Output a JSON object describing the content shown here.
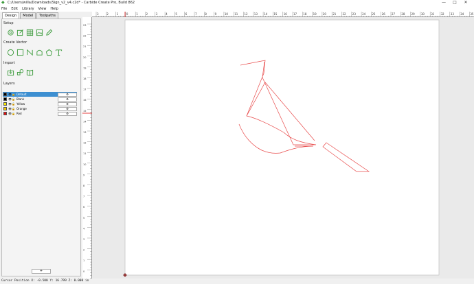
{
  "window": {
    "title": "C:/Users/willa/Downloads/Sign_v2_v4.c2d* - Carbide Create Pro, Build 862",
    "minimize": "—",
    "maximize": "□",
    "close": "✕"
  },
  "menu": [
    "File",
    "Edit",
    "Library",
    "View",
    "Help"
  ],
  "tabs": [
    "Design",
    "Model",
    "Toolpaths"
  ],
  "sections": {
    "setup": "Setup",
    "create_vector": "Create Vector",
    "import": "Import",
    "layers": "Layers"
  },
  "layers": [
    {
      "name": "Default",
      "color": "#000000",
      "selected": true
    },
    {
      "name": "Blank",
      "color": "#000000",
      "selected": false
    },
    {
      "name": "Yellow",
      "color": "#f5e600",
      "selected": false
    },
    {
      "name": "Orange",
      "color": "#f5c800",
      "selected": false
    },
    {
      "name": "Red",
      "color": "#e01010",
      "selected": false
    }
  ],
  "add_layer_label": "+",
  "ruler": {
    "top_labels": [
      "3",
      "2",
      "1",
      "0",
      "1",
      "2",
      "3",
      "4",
      "5",
      "6",
      "7",
      "8",
      "9",
      "10",
      "11",
      "12",
      "13",
      "14",
      "15",
      "16",
      "17",
      "18",
      "19",
      "20",
      "21",
      "22",
      "23",
      "24",
      "25",
      "26",
      "27",
      "28",
      "29",
      "30",
      "31",
      "32",
      "33",
      "34",
      "35"
    ],
    "left_labels": [
      "23",
      "22",
      "21",
      "20",
      "19",
      "18",
      "17",
      "16",
      "15",
      "14",
      "13",
      "12",
      "11",
      "10",
      "9",
      "8",
      "7",
      "6",
      "5",
      "4",
      "3",
      "2",
      "1",
      "0"
    ]
  },
  "status": "Cursor Position X: -0.500 Y: 16.799 Z: 0.000 in",
  "colors": {
    "accent_green": "#3a9a3a",
    "selection_blue": "#3d8fd1",
    "vector_red": "#e84a4a"
  }
}
